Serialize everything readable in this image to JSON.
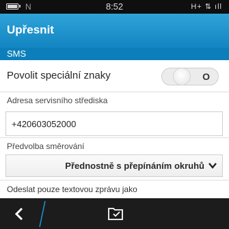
{
  "status_bar": {
    "notification_letter": "N",
    "time": "8:52",
    "network": "H+ ⇅ ıll",
    "icons": [
      "battery-icon",
      "signal-icon"
    ]
  },
  "header": {
    "title": "Upřesnit"
  },
  "section": {
    "title": "SMS"
  },
  "settings": {
    "special_chars_label": "Povolit speciální znaky",
    "special_chars_toggle_state": "O",
    "special_chars_enabled": false,
    "service_center_label": "Adresa servisního střediska",
    "service_center_value": "+420603052000",
    "routing_label": "Předvolba směrování",
    "routing_value": "Přednostně s přepínáním okruhů",
    "send_as_label": "Odeslat pouze textovou zprávu jako"
  },
  "action_bar": {
    "back_icon": "back-chevron-icon",
    "action_icon": "folder-check-icon"
  },
  "colors": {
    "title_bar": "#1a8fcc",
    "section_header": "#0c7fba",
    "action_bar": "#1c1c1c",
    "accent_slash": "#1e8fd0"
  }
}
